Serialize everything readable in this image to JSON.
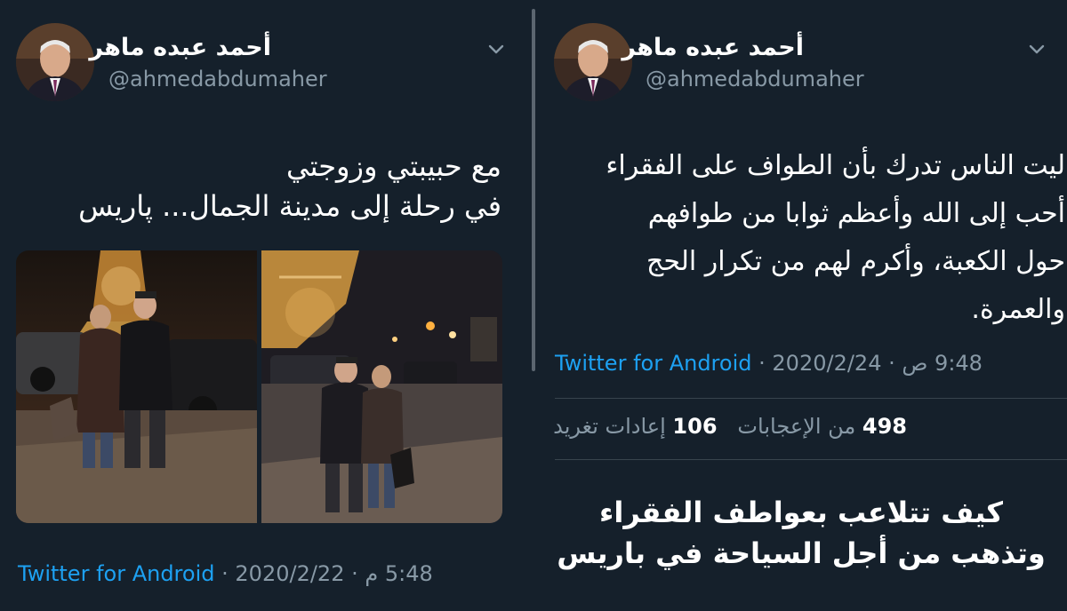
{
  "left_tweet": {
    "author_name": "أحمد عبده ماهر",
    "handle": "@ahmedabdumaher",
    "text_lines": [
      "مع حبيبتي وزوجتي",
      "في رحلة إلى مدينة الجمال... پاريس"
    ],
    "time": "5:48 م",
    "dot1": "·",
    "date": "2020/2/22",
    "dot2": "·",
    "source": "Twitter for Android"
  },
  "right_tweet": {
    "author_name": "أحمد عبده ماهر",
    "handle": "@ahmedabdumaher",
    "text_lines": [
      "ليت الناس تدرك بأن الطواف على الفقراء",
      "أحب إلى الله وأعظم ثوابا من طوافهم",
      "حول الكعبة، وأكرم لهم من تكرار الحج",
      "والعمرة."
    ],
    "time": "9:48 ص",
    "dot1": "·",
    "date": "2020/2/24",
    "dot2": "·",
    "source": "Twitter for Android",
    "likes_count": "498",
    "likes_label": "من الإعجابات",
    "retweets_count": "106",
    "retweets_label": "إعادات تغريد"
  },
  "caption_lines": [
    "كيف تتلاعب بعواطف الفقراء",
    "وتذهب من أجل السياحة في باريس"
  ],
  "icons": {
    "avatar": "profile-photo",
    "chevron": "chevron-down-icon"
  },
  "colors": {
    "background": "#15202b",
    "link": "#1da1f2",
    "muted": "#8899a6",
    "text": "#ffffff"
  }
}
